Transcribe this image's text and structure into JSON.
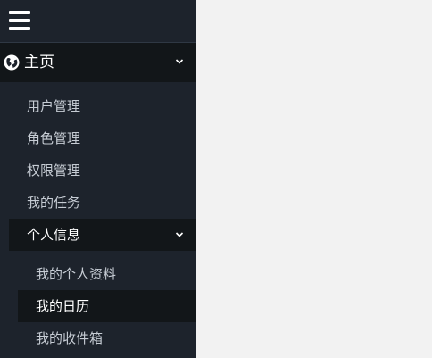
{
  "sidebar": {
    "home": {
      "label": "主页",
      "icon": "globe-icon"
    },
    "items": [
      {
        "label": "用户管理"
      },
      {
        "label": "角色管理"
      },
      {
        "label": "权限管理"
      },
      {
        "label": "我的任务"
      }
    ],
    "profile": {
      "label": "个人信息",
      "children": [
        {
          "label": "我的个人资料"
        },
        {
          "label": "我的日历",
          "active": true
        },
        {
          "label": "我的收件箱"
        }
      ]
    }
  },
  "colors": {
    "sidebar_bg": "#1d232c",
    "active_bg": "#121619",
    "content_bg": "#f2f2f2",
    "text": "#c6ccd4",
    "active_text": "#ffffff"
  }
}
